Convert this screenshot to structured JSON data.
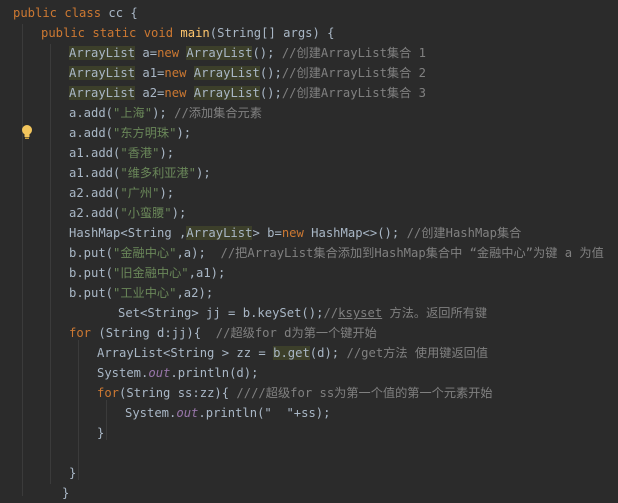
{
  "lines": [
    {
      "t": [
        {
          "c": "kw",
          "s": "public class "
        },
        {
          "c": "",
          "s": "cc {"
        }
      ]
    },
    {
      "t": [
        {
          "c": "kw",
          "s": "public static void "
        },
        {
          "c": "fn",
          "s": "main"
        },
        {
          "c": "",
          "s": "(String[] args) {"
        }
      ]
    },
    {
      "t": [
        {
          "c": "type-hl",
          "s": "ArrayList"
        },
        {
          "c": "",
          "s": " a="
        },
        {
          "c": "kw",
          "s": "new "
        },
        {
          "c": "type-hl",
          "s": "ArrayList"
        },
        {
          "c": "",
          "s": "(); "
        },
        {
          "c": "cmt",
          "s": "//创建ArrayList集合 1"
        }
      ]
    },
    {
      "t": [
        {
          "c": "type-hl",
          "s": "ArrayList"
        },
        {
          "c": "",
          "s": " a1="
        },
        {
          "c": "kw",
          "s": "new "
        },
        {
          "c": "type-hl",
          "s": "ArrayList"
        },
        {
          "c": "",
          "s": "();"
        },
        {
          "c": "cmt",
          "s": "//创建ArrayList集合 2"
        }
      ]
    },
    {
      "t": [
        {
          "c": "type-hl",
          "s": "ArrayList"
        },
        {
          "c": "",
          "s": " a2="
        },
        {
          "c": "kw",
          "s": "new "
        },
        {
          "c": "type-hl",
          "s": "ArrayList"
        },
        {
          "c": "",
          "s": "();"
        },
        {
          "c": "cmt",
          "s": "//创建ArrayList集合 3"
        }
      ]
    },
    {
      "t": [
        {
          "c": "",
          "s": "a.add("
        },
        {
          "c": "str",
          "s": "\"上海\""
        },
        {
          "c": "",
          "s": "); "
        },
        {
          "c": "cmt",
          "s": "//添加集合元素"
        }
      ]
    },
    {
      "t": [
        {
          "c": "",
          "s": "a.add("
        },
        {
          "c": "str",
          "s": "\"东方明珠\""
        },
        {
          "c": "",
          "s": ");"
        }
      ]
    },
    {
      "t": [
        {
          "c": "",
          "s": "a1.add("
        },
        {
          "c": "str",
          "s": "\"香港\""
        },
        {
          "c": "",
          "s": ");"
        }
      ]
    },
    {
      "t": [
        {
          "c": "",
          "s": "a1.add("
        },
        {
          "c": "str",
          "s": "\"维多利亚港\""
        },
        {
          "c": "",
          "s": ");"
        }
      ]
    },
    {
      "t": [
        {
          "c": "",
          "s": "a2.add("
        },
        {
          "c": "str",
          "s": "\"广州\""
        },
        {
          "c": "",
          "s": ");"
        }
      ]
    },
    {
      "t": [
        {
          "c": "",
          "s": "a2.add("
        },
        {
          "c": "str",
          "s": "\"小蛮腰\""
        },
        {
          "c": "",
          "s": ");"
        }
      ]
    },
    {
      "t": [
        {
          "c": "",
          "s": "HashMap<String ,"
        },
        {
          "c": "type-hl",
          "s": "ArrayList"
        },
        {
          "c": "",
          "s": "> b="
        },
        {
          "c": "kw",
          "s": "new "
        },
        {
          "c": "",
          "s": "HashMap<>(); "
        },
        {
          "c": "cmt",
          "s": "//创建HashMap集合"
        }
      ]
    },
    {
      "t": [
        {
          "c": "",
          "s": "b.put("
        },
        {
          "c": "str",
          "s": "\"金融中心\""
        },
        {
          "c": "",
          "s": ",a);  "
        },
        {
          "c": "cmt",
          "s": "//把ArrayList集合添加到HashMap集合中 “金融中心”为键 a 为值"
        }
      ]
    },
    {
      "t": [
        {
          "c": "",
          "s": "b.put("
        },
        {
          "c": "str",
          "s": "\"旧金融中心\""
        },
        {
          "c": "",
          "s": ",a1);"
        }
      ]
    },
    {
      "t": [
        {
          "c": "",
          "s": "b.put("
        },
        {
          "c": "str",
          "s": "\"工业中心\""
        },
        {
          "c": "",
          "s": ",a2);"
        }
      ]
    },
    {
      "t": [
        {
          "c": "",
          "s": "Set<String> jj = b.keySet();"
        },
        {
          "c": "cmt",
          "s": "//"
        },
        {
          "c": "cmt under",
          "s": "ksyset"
        },
        {
          "c": "cmt",
          "s": " 方法。返回所有键"
        }
      ]
    },
    {
      "t": [
        {
          "c": "kw",
          "s": "for "
        },
        {
          "c": "",
          "s": "(String d:jj){  "
        },
        {
          "c": "cmt",
          "s": "//超级for d为第一个键开始"
        }
      ]
    },
    {
      "t": [
        {
          "c": "",
          "s": "ArrayList<String > zz = "
        },
        {
          "c": "type-hl",
          "s": "b.get"
        },
        {
          "c": "",
          "s": "(d); "
        },
        {
          "c": "cmt",
          "s": "//get方法 使用键返回值"
        }
      ]
    },
    {
      "t": [
        {
          "c": "",
          "s": "System."
        },
        {
          "c": "fld",
          "s": "out"
        },
        {
          "c": "",
          "s": ".println(d);"
        }
      ]
    },
    {
      "t": [
        {
          "c": "kw",
          "s": "for"
        },
        {
          "c": "",
          "s": "(String ss:zz){ "
        },
        {
          "c": "cmt",
          "s": "////超级for ss为第一个值的第一个元素开始"
        }
      ]
    },
    {
      "t": [
        {
          "c": "",
          "s": "System."
        },
        {
          "c": "fld",
          "s": "out"
        },
        {
          "c": "",
          "s": ".println(\"  \"+ss);"
        }
      ]
    },
    {
      "t": [
        {
          "c": "",
          "s": "}"
        }
      ]
    },
    {
      "t": [
        {
          "c": "",
          "s": ""
        }
      ]
    },
    {
      "t": [
        {
          "c": "",
          "s": "}"
        }
      ]
    },
    {
      "t": [
        {
          "c": "",
          "s": "}"
        }
      ]
    }
  ]
}
